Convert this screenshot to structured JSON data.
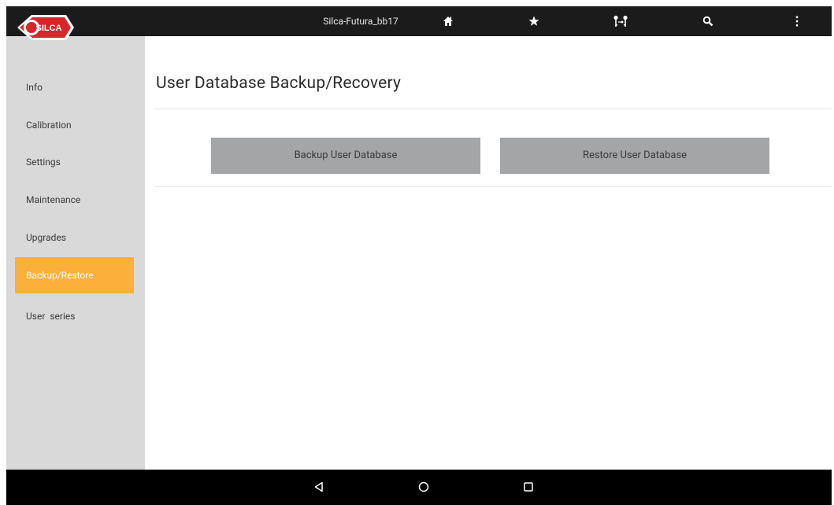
{
  "topbar": {
    "app_title": "Silca-Futura_bb17",
    "icons": [
      "home-icon",
      "star-icon",
      "key-swap-icon",
      "search-icon",
      "more-vert-icon"
    ]
  },
  "logo": {
    "text": "SILCA"
  },
  "sidebar": {
    "items": [
      {
        "label": "Info",
        "active": false
      },
      {
        "label": "Calibration",
        "active": false
      },
      {
        "label": "Settings",
        "active": false
      },
      {
        "label": "Maintenance",
        "active": false
      },
      {
        "label": "Upgrades",
        "active": false
      },
      {
        "label": "Backup/Restore",
        "active": true
      },
      {
        "label": "User  series",
        "active": false
      }
    ]
  },
  "main": {
    "title": "User Database Backup/Recovery",
    "backup_button": "Backup User Database",
    "restore_button": "Restore User Database"
  },
  "navbar": {
    "icons": [
      "back-icon",
      "home-circle-icon",
      "recents-icon"
    ]
  },
  "colors": {
    "topbar": "#1b1b1b",
    "sidebar": "#d9d9d9",
    "active_item": "#fbb03b",
    "button": "#a3a5a7",
    "brand_red": "#d7262a"
  }
}
